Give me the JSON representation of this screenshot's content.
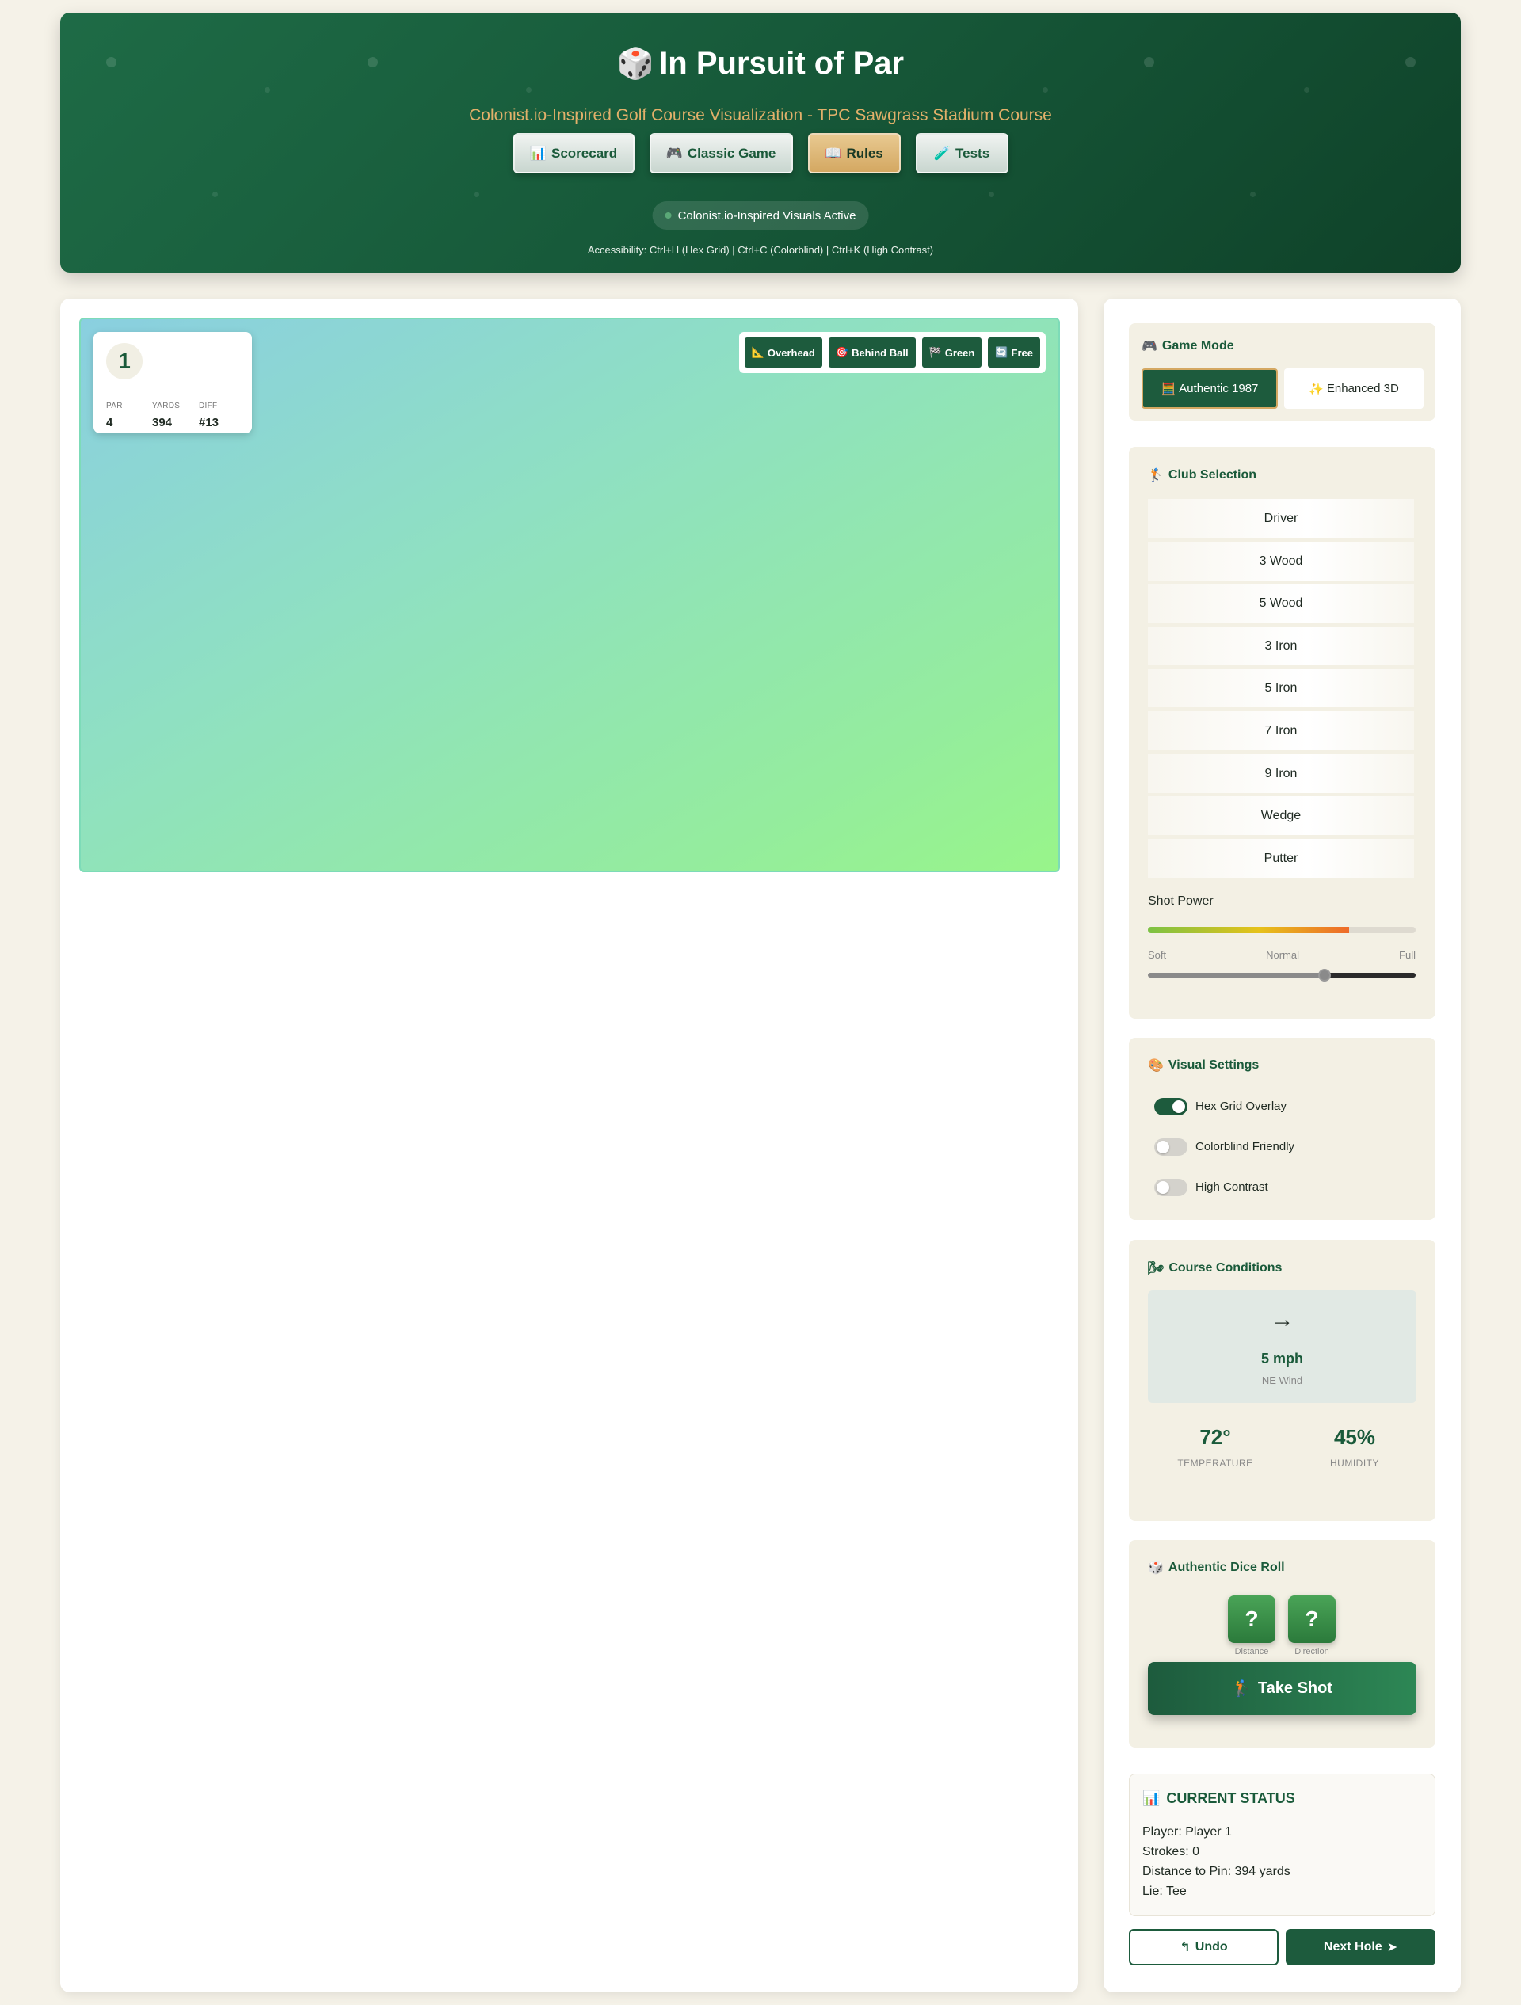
{
  "header": {
    "title": "In Pursuit of Par",
    "title_icon": "🎲",
    "subtitle": "Colonist.io-Inspired Golf Course Visualization - TPC Sawgrass Stadium Course",
    "nav": [
      {
        "icon": "📊",
        "label": "Scorecard"
      },
      {
        "icon": "🎮",
        "label": "Classic Game"
      },
      {
        "icon": "📖",
        "label": "Rules"
      },
      {
        "icon": "🧪",
        "label": "Tests"
      }
    ],
    "status_pill": "Colonist.io-Inspired Visuals Active",
    "accessibility": "Accessibility: Ctrl+H (Hex Grid) | Ctrl+C (Colorblind) | Ctrl+K (High Contrast)"
  },
  "hole_info": {
    "number": "1",
    "par_label": "PAR",
    "par": "4",
    "yards_label": "YARDS",
    "yards": "394",
    "diff_label": "DIFF",
    "diff": "#13"
  },
  "camera_views": [
    {
      "icon": "📐",
      "label": "Overhead"
    },
    {
      "icon": "🎯",
      "label": "Behind Ball"
    },
    {
      "icon": "🏁",
      "label": "Green"
    },
    {
      "icon": "🔄",
      "label": "Free"
    }
  ],
  "game_mode": {
    "title": "Game Mode",
    "icon": "🎮",
    "options": [
      {
        "icon": "🧮",
        "label": "Authentic 1987",
        "selected": true
      },
      {
        "icon": "✨",
        "label": "Enhanced 3D",
        "selected": false
      }
    ]
  },
  "club_selection": {
    "title": "Club Selection",
    "icon": "🏌",
    "clubs": [
      "Driver",
      "3 Wood",
      "5 Wood",
      "3 Iron",
      "5 Iron",
      "7 Iron",
      "9 Iron",
      "Wedge",
      "Putter"
    ],
    "shot_power_label": "Shot Power",
    "power_fraction": 0.75,
    "slider_fraction": 0.66,
    "ticks": [
      "Soft",
      "Normal",
      "Full"
    ]
  },
  "visual_settings": {
    "title": "Visual Settings",
    "icon": "🎨",
    "toggles": [
      {
        "label": "Hex Grid Overlay",
        "on": true
      },
      {
        "label": "Colorblind Friendly",
        "on": false
      },
      {
        "label": "High Contrast",
        "on": false
      }
    ]
  },
  "course_conditions": {
    "title": "Course Conditions",
    "icon": "🌬",
    "wind_arrow": "→",
    "wind_speed": "5 mph",
    "wind_dir": "NE Wind",
    "temperature": "72°",
    "temperature_label": "TEMPERATURE",
    "humidity": "45%",
    "humidity_label": "HUMIDITY"
  },
  "dice": {
    "title": "Authentic Dice Roll",
    "icon": "🎲",
    "die1": "?",
    "die1_label": "Distance",
    "die2": "?",
    "die2_label": "Direction",
    "shot_icon": "🏌",
    "shot_label": "Take Shot"
  },
  "status": {
    "icon": "📊",
    "title": "CURRENT STATUS",
    "player": "Player: Player 1",
    "strokes": "Strokes: 0",
    "distance": "Distance to Pin: 394 yards",
    "lie": "Lie: Tee"
  },
  "actions": {
    "undo_icon": "↰",
    "undo": "Undo",
    "next": "Next Hole",
    "next_icon": "➤"
  },
  "colors": {
    "primary": "#1d5b3d",
    "accent": "#d4a862",
    "background": "#f5f2e8"
  }
}
